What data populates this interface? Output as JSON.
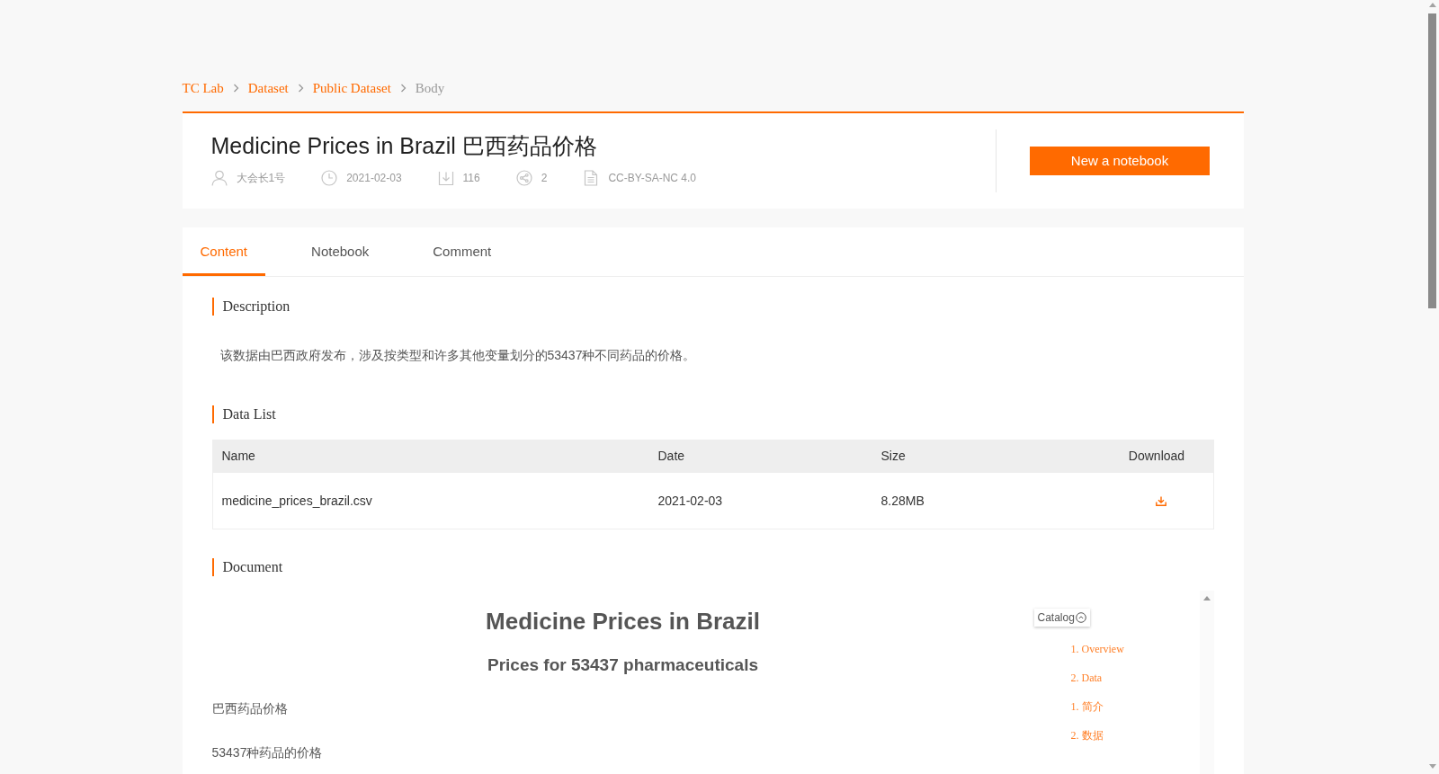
{
  "breadcrumb": [
    {
      "label": "TC Lab",
      "current": false
    },
    {
      "label": "Dataset",
      "current": false
    },
    {
      "label": "Public Dataset",
      "current": false
    },
    {
      "label": "Body",
      "current": true
    }
  ],
  "header": {
    "title": "Medicine Prices in Brazil 巴西药品价格",
    "meta": [
      {
        "kind": "author",
        "text": "大会长1号"
      },
      {
        "kind": "date",
        "text": "2021-02-03"
      },
      {
        "kind": "downloads",
        "text": "116"
      },
      {
        "kind": "shares",
        "text": "2"
      },
      {
        "kind": "license",
        "text": "CC-BY-SA-NC 4.0"
      }
    ],
    "action_button": "New a notebook"
  },
  "tabs": [
    {
      "label": "Content",
      "selected": true
    },
    {
      "label": "Notebook",
      "selected": false
    },
    {
      "label": "Comment",
      "selected": false
    }
  ],
  "description": {
    "heading": "Description",
    "text": "该数据由巴西政府发布，涉及按类型和许多其他变量划分的53437种不同药品的价格。"
  },
  "data_list": {
    "heading": "Data List",
    "columns": [
      "Name",
      "Date",
      "Size",
      "Download"
    ],
    "rows": [
      {
        "name": "medicine_prices_brazil.csv",
        "date": "2021-02-03",
        "size": "8.28MB"
      }
    ]
  },
  "document": {
    "heading": "Document",
    "title": "Medicine Prices in Brazil",
    "subtitle": "Prices for 53437 pharmaceuticals",
    "paragraphs": [
      "巴西药品价格",
      "53437种药品的价格"
    ],
    "catalog": {
      "label": "Catalog",
      "expanded": true,
      "items": [
        "1. Overview",
        "2. Data",
        "1. 简介",
        "2. 数据"
      ]
    }
  }
}
